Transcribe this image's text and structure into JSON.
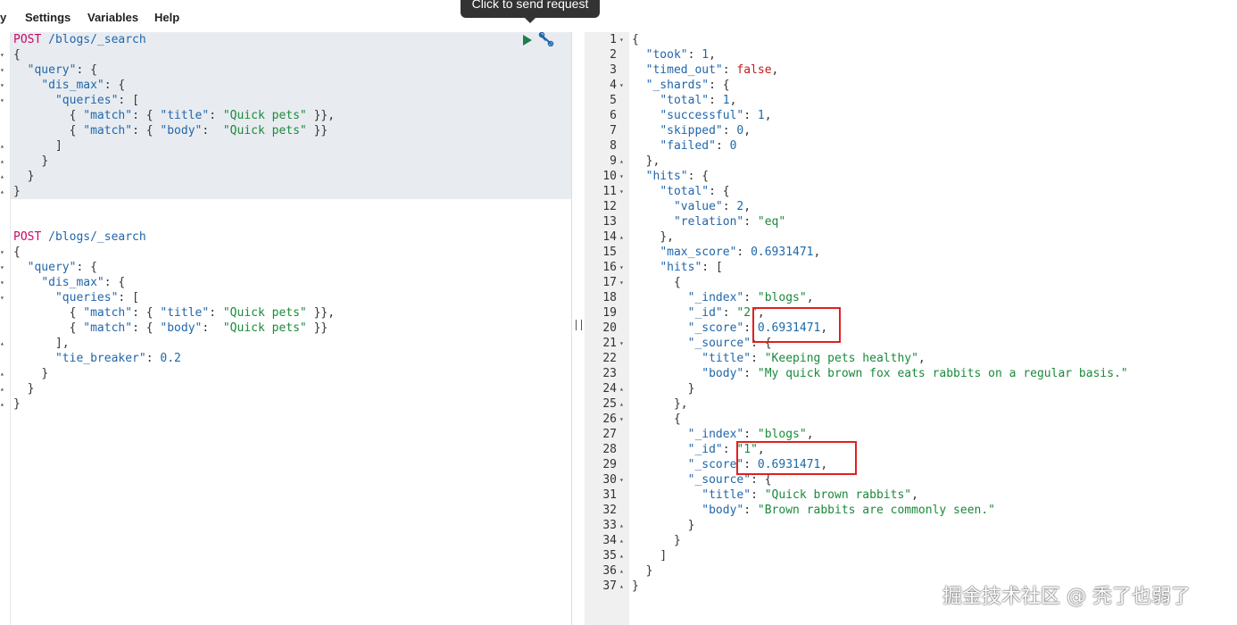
{
  "menubar": {
    "items": [
      "y",
      "Settings",
      "Variables",
      "Help"
    ],
    "tooltip": "Click to send request"
  },
  "left": {
    "request1": {
      "method": "POST",
      "url": "/blogs/_search",
      "lines": [
        "{",
        "  \"query\": {",
        "    \"dis_max\": {",
        "      \"queries\": [",
        "        { \"match\": { \"title\": \"Quick pets\" }},",
        "        { \"match\": { \"body\":  \"Quick pets\" }}",
        "      ]",
        "    }",
        "  }",
        "}"
      ]
    },
    "request2": {
      "method": "POST",
      "url": "/blogs/_search",
      "lines": [
        "{",
        "  \"query\": {",
        "    \"dis_max\": {",
        "      \"queries\": [",
        "        { \"match\": { \"title\": \"Quick pets\" }},",
        "        { \"match\": { \"body\":  \"Quick pets\" }}",
        "      ],",
        "      \"tie_breaker\": 0.2",
        "    }",
        "  }",
        "}"
      ]
    },
    "icons": {
      "send": "play-icon",
      "settings": "wrench-icon"
    }
  },
  "right": {
    "lines": [
      "{",
      "  \"took\": 1,",
      "  \"timed_out\": false,",
      "  \"_shards\": {",
      "    \"total\": 1,",
      "    \"successful\": 1,",
      "    \"skipped\": 0,",
      "    \"failed\": 0",
      "  },",
      "  \"hits\": {",
      "    \"total\": {",
      "      \"value\": 2,",
      "      \"relation\": \"eq\"",
      "    },",
      "    \"max_score\": 0.6931471,",
      "    \"hits\": [",
      "      {",
      "        \"_index\": \"blogs\",",
      "        \"_id\": \"2\",",
      "        \"_score\": 0.6931471,",
      "        \"_source\": {",
      "          \"title\": \"Keeping pets healthy\",",
      "          \"body\": \"My quick brown fox eats rabbits on a regular basis.\"",
      "        }",
      "      },",
      "      {",
      "        \"_index\": \"blogs\",",
      "        \"_id\": \"1\",",
      "        \"_score\": 0.6931471,",
      "        \"_source\": {",
      "          \"title\": \"Quick brown rabbits\",",
      "          \"body\": \"Brown rabbits are commonly seen.\"",
      "        }",
      "      }",
      "    ]",
      "  }",
      "}"
    ]
  },
  "watermark": "掘金技术社区 @ 秃了也弱了",
  "colors": {
    "method": "#c80a68",
    "key": "#2266aa",
    "string": "#1a8a3a",
    "bool": "#c41a16",
    "highlight": "#e02020"
  }
}
